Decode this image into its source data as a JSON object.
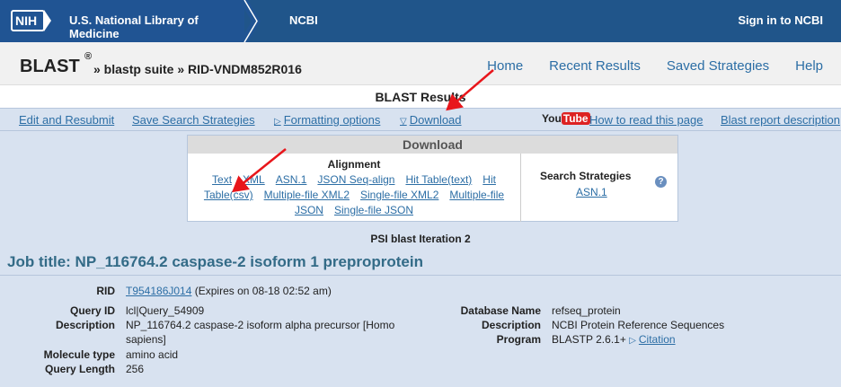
{
  "topbar": {
    "nih_logo": "NIH",
    "library": "U.S. National Library of Medicine",
    "ncbi": "NCBI",
    "sign_in": "Sign in to NCBI"
  },
  "subbar": {
    "brand": "BLAST",
    "reg": "®",
    "crumb": "» blastp suite » RID-VNDM852R016",
    "nav": [
      "Home",
      "Recent Results",
      "Saved Strategies",
      "Help"
    ]
  },
  "results_title": "BLAST Results",
  "linkbar": {
    "edit": "Edit and Resubmit",
    "save": "Save Search Strategies",
    "formatting": "Formatting options",
    "download": "Download",
    "youtube_you": "You",
    "youtube_tube": "Tube",
    "how_to": "How to read this page",
    "report_desc": "Blast report description"
  },
  "download_panel": {
    "title": "Download",
    "alignment_title": "Alignment",
    "row1": [
      "Text",
      "XML",
      "ASN.1",
      "JSON Seq-align",
      "Hit Table(text)",
      "Hit"
    ],
    "row2": [
      "Table(csv)",
      "Multiple-file XML2",
      "Single-file XML2",
      "Multiple-file"
    ],
    "row3": [
      "JSON",
      "Single-file JSON"
    ],
    "search_strategies_title": "Search Strategies",
    "search_strategies_link": "ASN.1",
    "help_symbol": "?"
  },
  "psi_iteration": "PSI blast Iteration 2",
  "job_title": "Job title: NP_116764.2 caspase-2 isoform 1 preproprotein",
  "job_info": {
    "rid_label": "RID",
    "rid_value": "T954186J014",
    "rid_expiry": "(Expires on 08-18 02:52 am)",
    "query_id_label": "Query ID",
    "query_id": "lcl|Query_54909",
    "description_label": "Description",
    "description_line1": "NP_116764.2 caspase-2 isoform alpha precursor [Homo",
    "description_line2": "sapiens]",
    "molecule_type_label": "Molecule type",
    "molecule_type": "amino acid",
    "query_length_label": "Query Length",
    "query_length": "256",
    "database_name_label": "Database Name",
    "database_name": "refseq_protein",
    "db_description_label": "Description",
    "db_description": "NCBI Protein Reference Sequences",
    "program_label": "Program",
    "program": "BLASTP 2.6.1+",
    "citation": "Citation"
  },
  "colors": {
    "header_blue": "#20558a",
    "link_blue": "#2c6ea5",
    "panel_bg": "#d8e2f0",
    "arrow_red": "#e8161b"
  }
}
